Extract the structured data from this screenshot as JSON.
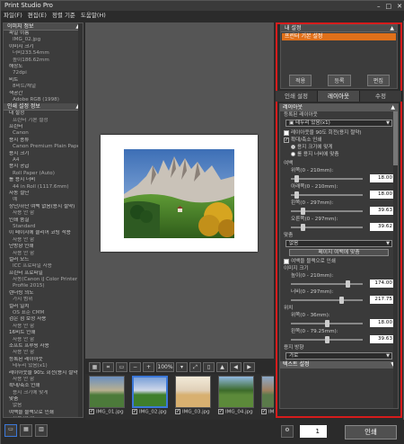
{
  "window": {
    "title": "Print Studio Pro"
  },
  "menu": [
    "파일(F)",
    "편집(E)",
    "정렬 기준",
    "도움말(H)"
  ],
  "image_info": {
    "header": "이미지 정보",
    "rows": [
      {
        "t": "파일 이름",
        "v": false
      },
      {
        "t": "IMG_02.jpg",
        "v": true
      },
      {
        "t": "이미지 크기",
        "v": false
      },
      {
        "t": "너비233.54mm",
        "v": true
      },
      {
        "t": "높이186.62mm",
        "v": true
      },
      {
        "t": "해상도",
        "v": false
      },
      {
        "t": "72dpi",
        "v": true
      },
      {
        "t": "비트",
        "v": false
      },
      {
        "t": "8비트/채널",
        "v": true
      },
      {
        "t": "색공간",
        "v": false
      },
      {
        "t": "Adobe RGB (1998)",
        "v": true
      }
    ]
  },
  "print_info": {
    "header": "인쇄 설정 정보",
    "rows": [
      {
        "t": "내 설정",
        "v": false
      },
      {
        "t": "프린터 기본 설정",
        "v": true
      },
      {
        "t": "프린터",
        "v": false
      },
      {
        "t": "Canon",
        "v": true
      },
      {
        "t": "용지 종류",
        "v": false
      },
      {
        "t": "Canon Premium Plain Paper 80",
        "v": true
      },
      {
        "t": "용지 크기",
        "v": false
      },
      {
        "t": "A4",
        "v": true
      },
      {
        "t": "용지 공급",
        "v": false
      },
      {
        "t": "Roll Paper (Auto)",
        "v": true
      },
      {
        "t": "롤 용지 너비",
        "v": false
      },
      {
        "t": "44 in Roll (1117.6mm)",
        "v": true
      },
      {
        "t": "자동 절단",
        "v": false
      },
      {
        "t": "예",
        "v": true
      },
      {
        "t": "상단/하단 여백 없음(용지 절약)",
        "v": false
      },
      {
        "t": "사용 안 함",
        "v": true
      },
      {
        "t": "인쇄 품질",
        "v": false
      },
      {
        "t": "Standard",
        "v": true
      },
      {
        "t": "이 페이지에 클리어 코팅 적용",
        "v": false
      },
      {
        "t": "사용 안 함",
        "v": true
      },
      {
        "t": "단방향 인쇄",
        "v": false
      },
      {
        "t": "사용 안 함",
        "v": true
      },
      {
        "t": "컬러 모드",
        "v": false
      },
      {
        "t": "ICC 프로파일 사용",
        "v": true
      },
      {
        "t": "프린터 프로파일",
        "v": false
      },
      {
        "t": "자동(Canon iJ Color Printer",
        "v": true
      },
      {
        "t": "Profile 2015)",
        "v": true
      },
      {
        "t": "렌더링 의도",
        "v": false
      },
      {
        "t": "가시 범위",
        "v": true
      },
      {
        "t": "컬러 일치",
        "v": false
      },
      {
        "t": "OS 표준 CMM",
        "v": true
      },
      {
        "t": "검은 점 보정 사용",
        "v": false
      },
      {
        "t": "사용 안 함",
        "v": true
      },
      {
        "t": "16비트 인쇄",
        "v": false
      },
      {
        "t": "사용 안 함",
        "v": true
      },
      {
        "t": "소프트 프루핑 사용",
        "v": false
      },
      {
        "t": "사용 안 함",
        "v": true
      },
      {
        "t": "등록된 레이아웃",
        "v": false
      },
      {
        "t": "테두리 있음(x1)",
        "v": true
      },
      {
        "t": "레이아웃을 90도 회전(용지 절약)",
        "v": false
      },
      {
        "t": "사용 안 함",
        "v": true
      },
      {
        "t": "확대/축소 인쇄",
        "v": false
      },
      {
        "t": "용지 크기에 맞게",
        "v": true
      },
      {
        "t": "맞춤",
        "v": false
      },
      {
        "t": "없음",
        "v": true
      },
      {
        "t": "여백을 블랙으로 인쇄",
        "v": false
      },
      {
        "t": "사용 안 함",
        "v": true
      },
      {
        "t": "용지 방향",
        "v": false
      },
      {
        "t": "가로",
        "v": true
      },
      {
        "t": "컬러 균형",
        "v": false
      }
    ]
  },
  "zoom": "100%",
  "thumbnails": [
    {
      "label": "IMG_01.jpg",
      "selected": false,
      "colors": [
        "#6a8fc0",
        "#4c7a3a",
        "#b8b090"
      ]
    },
    {
      "label": "IMG_02.jpg",
      "selected": true,
      "colors": [
        "#7aa0d8",
        "#3f7f2c",
        "#cfd7e8"
      ]
    },
    {
      "label": "IMG_03.jpg",
      "selected": false,
      "colors": [
        "#f2ead8",
        "#d8b070",
        "#e0d0b8"
      ]
    },
    {
      "label": "IMG_04.jpg",
      "selected": false,
      "colors": [
        "#90b8e0",
        "#5c8a3a",
        "#3c6a2a"
      ]
    },
    {
      "label": "IMG_05.",
      "selected": false,
      "colors": [
        "#8aa8c8",
        "#5a7a4a",
        "#a08060"
      ]
    }
  ],
  "my_settings": {
    "header": "내 설정",
    "selected": "프린터 기본 설정",
    "buttons": [
      "적용",
      "등록",
      "편집"
    ]
  },
  "tabs": [
    "인쇄 설정",
    "레이아웃",
    "수정"
  ],
  "layout": {
    "header": "레이아웃",
    "registered_label": "등록된 레이아웃",
    "registered_value": "테두리 있음(x1)",
    "rotate_label": "레이아웃을 90도 회전(용지 절약)",
    "scale_label": "확대/축소 인쇄",
    "fit_paper": "용지 크기에 맞게",
    "fit_roll": "롤 용지 너비에 맞춤",
    "margin_label": "여백",
    "margins": [
      {
        "label": "위쪽(0 - 210mm):",
        "value": "18.00",
        "pos": 0.05
      },
      {
        "label": "아래쪽(0 - 210mm):",
        "value": "18.00",
        "pos": 0.05
      },
      {
        "label": "왼쪽(0 - 297mm):",
        "value": "39.63",
        "pos": 0.14
      },
      {
        "label": "오른쪽(0 - 297mm):",
        "value": "39.62",
        "pos": 0.14
      }
    ],
    "fit_label": "맞춤",
    "fit_value": "없음",
    "fit_page_button": "페이지 여백에 맞춤",
    "black_margin": "여백을 블랙으로 인쇄",
    "image_size_label": "이미지 크기",
    "sizes": [
      {
        "label": "높이(0 - 210mm):",
        "value": "174.00",
        "pos": 0.82
      },
      {
        "label": "너비(0 - 297mm):",
        "value": "217.75",
        "pos": 0.72
      }
    ],
    "position_label": "위치",
    "positions": [
      {
        "label": "위쪽(0 - 36mm):",
        "value": "18.00",
        "pos": 0.5
      },
      {
        "label": "왼쪽(0 - 79.25mm):",
        "value": "39.63",
        "pos": 0.5
      }
    ],
    "orientation_label": "용지 방향",
    "orientation_value": "가로",
    "text_settings": "텍스트 설정"
  },
  "bottom": {
    "copies": "1",
    "print_button": "인쇄"
  }
}
